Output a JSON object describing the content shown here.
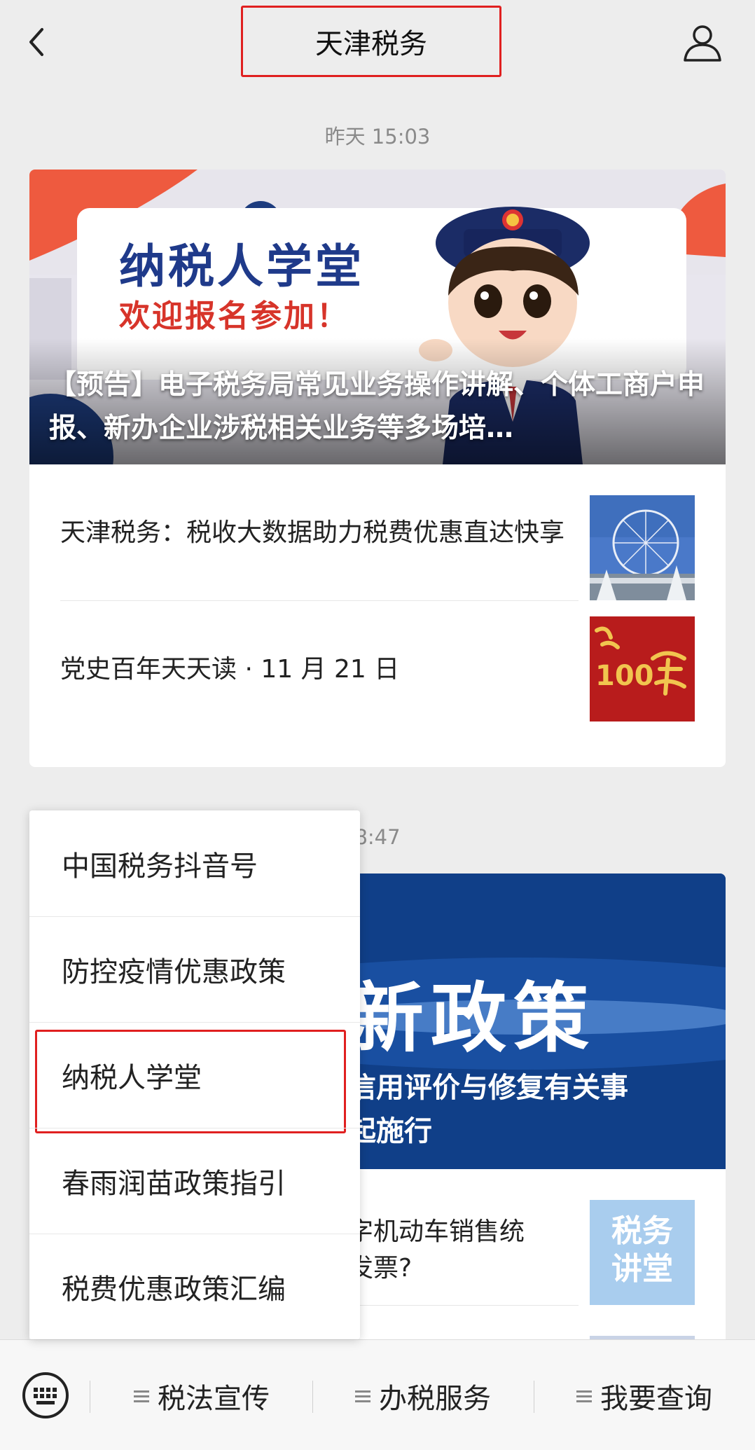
{
  "header": {
    "title": "天津税务"
  },
  "timestamps": [
    "昨天 15:03",
    "8:47"
  ],
  "card1": {
    "hero": {
      "banner_title": "纳税人学堂",
      "banner_subtitle": "欢迎报名参加！",
      "caption": "【预告】电子税务局常见业务操作讲解、个体工商户申报、新办企业涉税相关业务等多场培…"
    },
    "items": [
      {
        "title": "天津税务：税收大数据助力税费优惠直达快享",
        "thumb_icon": "ferris-wheel-photo"
      },
      {
        "title": "党史百年天天读 · 11 月 21 日",
        "thumb_icon": "party-history-100-logo",
        "thumb_text": "100"
      }
    ]
  },
  "card2": {
    "hero": {
      "banner_title": "新政策",
      "caption_line1": "信用评价与修复有关事",
      "caption_line2": "起施行"
    },
    "items": [
      {
        "title_line1": "字机动车销售统",
        "title_line2": "发票?",
        "thumb_text_1": "税务",
        "thumb_text_2": "讲堂"
      }
    ]
  },
  "popup_menu": {
    "items": [
      {
        "label": "中国税务抖音号"
      },
      {
        "label": "防控疫情优惠政策"
      },
      {
        "label": "纳税人学堂"
      },
      {
        "label": "春雨润苗政策指引"
      },
      {
        "label": "税费优惠政策汇编"
      }
    ],
    "selected_index": 2
  },
  "bottom_menu": {
    "items": [
      {
        "label": "税法宣传"
      },
      {
        "label": "办税服务"
      },
      {
        "label": "我要查询"
      }
    ]
  },
  "colors": {
    "highlight": "#e02020",
    "background": "#ededed",
    "card": "#ffffff"
  }
}
